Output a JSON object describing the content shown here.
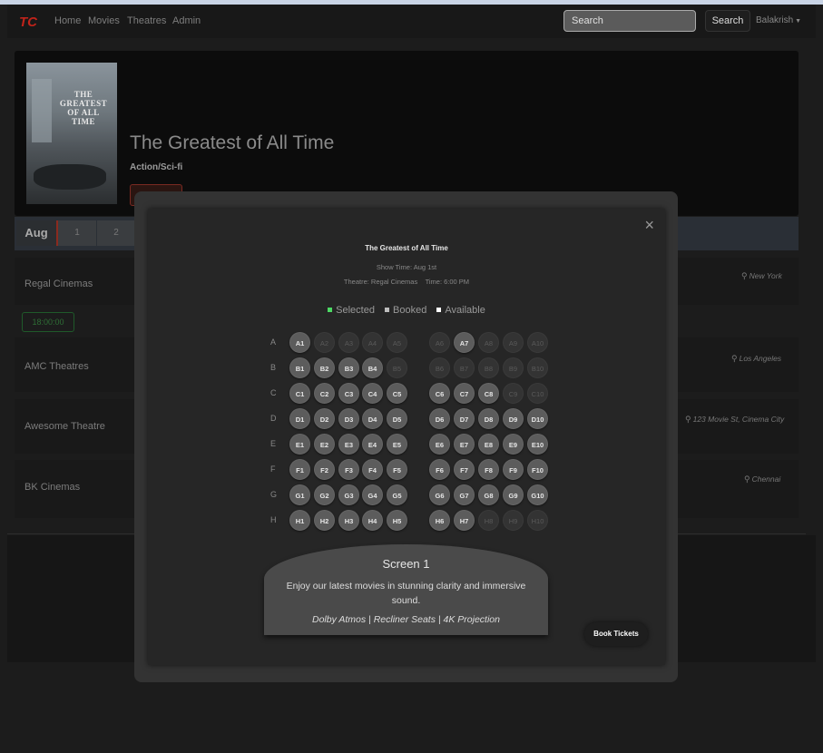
{
  "nav": {
    "brand": "TC",
    "links": [
      "Home",
      "Movies",
      "Theatres",
      "Admin"
    ],
    "search_placeholder": "Search",
    "search_button": "Search",
    "user": "Balakrish"
  },
  "movie": {
    "poster_text": "THE GREATEST OF ALL TIME",
    "title": "The Greatest of All Time",
    "genre": "Action/Sci-fi"
  },
  "dates": {
    "month": "Aug",
    "days": [
      "1",
      "2"
    ]
  },
  "theatres": [
    {
      "name": "Regal Cinemas",
      "location": "New York",
      "showtime": "18:00:00"
    },
    {
      "name": "AMC Theatres",
      "location": "Los Angeles"
    },
    {
      "name": "Awesome Theatre",
      "location": "123 Movie St, Cinema City"
    },
    {
      "name": "BK Cinemas",
      "location": "Chennai"
    }
  ],
  "modal": {
    "close": "×",
    "title": "The Greatest of All Time",
    "show_time": "Show Time: Aug 1st",
    "theatre": "Theatre: Regal Cinemas",
    "time": "Time: 6:00 PM",
    "legend": {
      "selected": "Selected",
      "booked": "Booked",
      "available": "Available",
      "selected_color": "#4cd964",
      "booked_color": "#bdbdbd",
      "available_color": "#ffffff"
    },
    "rows": [
      "A",
      "B",
      "C",
      "D",
      "E",
      "F",
      "G",
      "H"
    ],
    "seats_per_row": 10,
    "booked": {
      "A": [
        "A1",
        "A7"
      ],
      "B": [
        "B1",
        "B2",
        "B3",
        "B4"
      ],
      "C": [
        "C1",
        "C2",
        "C3",
        "C4",
        "C5",
        "C6",
        "C7",
        "C8"
      ],
      "D": [
        "D1",
        "D2",
        "D3",
        "D4",
        "D5",
        "D6",
        "D7",
        "D8",
        "D9",
        "D10"
      ],
      "E": [
        "E1",
        "E2",
        "E3",
        "E4",
        "E5",
        "E6",
        "E7",
        "E8",
        "E9",
        "E10"
      ],
      "F": [
        "F1",
        "F2",
        "F3",
        "F4",
        "F5",
        "F6",
        "F7",
        "F8",
        "F9",
        "F10"
      ],
      "G": [
        "G1",
        "G2",
        "G3",
        "G4",
        "G5",
        "G6",
        "G7",
        "G8",
        "G9",
        "G10"
      ],
      "H": [
        "H1",
        "H2",
        "H3",
        "H4",
        "H5",
        "H6",
        "H7"
      ]
    },
    "screen": {
      "title": "Screen 1",
      "description": "Enjoy our latest movies in stunning clarity and immersive sound.",
      "features": "Dolby Atmos | Recliner Seats | 4K Projection"
    },
    "book_button": "Book Tickets"
  }
}
